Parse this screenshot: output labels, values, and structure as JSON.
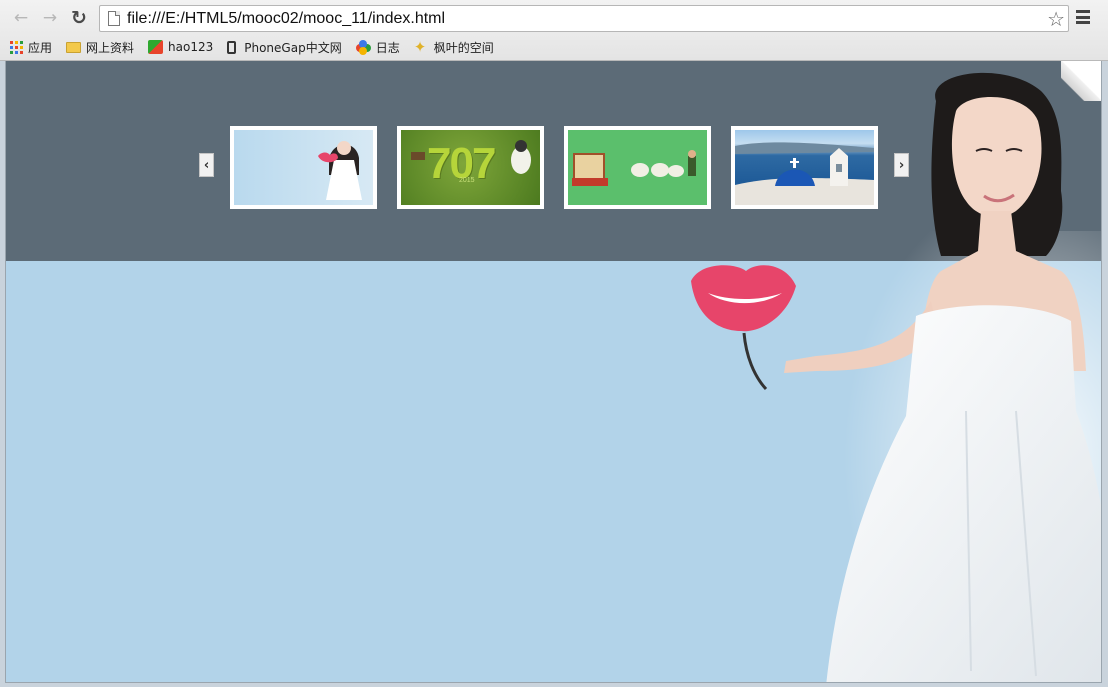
{
  "browser": {
    "url": "file:///E:/HTML5/mooc02/mooc_11/index.html",
    "bookmarks": [
      {
        "label": "应用",
        "icon": "apps-icon"
      },
      {
        "label": "网上资料",
        "icon": "folder-icon"
      },
      {
        "label": "hao123",
        "icon": "hao123-icon"
      },
      {
        "label": "PhoneGap中文网",
        "icon": "phone-icon"
      },
      {
        "label": "日志",
        "icon": "blog-icon"
      },
      {
        "label": "枫叶的空间",
        "icon": "star-leaf-icon"
      }
    ]
  },
  "carousel": {
    "prev_label": "‹",
    "next_label": "›",
    "thumb2_text": "707",
    "thumb2_year": "2015"
  },
  "colors": {
    "banner": "#5c6b77",
    "page_bg": "#b2d3e9",
    "accent_lips": "#e7456a"
  }
}
